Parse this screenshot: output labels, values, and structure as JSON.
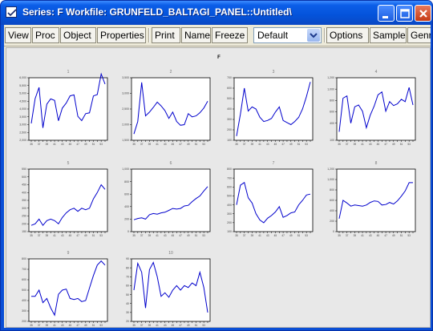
{
  "window": {
    "title": "Series: F   Workfile: GRUNFELD_BALTAGI_PANEL::Untitled\\",
    "controls": {
      "minimize": "minimize",
      "maximize": "maximize",
      "close": "close"
    }
  },
  "toolbar": {
    "view": "View",
    "proc": "Proc",
    "object": "Object",
    "properties": "Properties",
    "print": "Print",
    "name": "Name",
    "freeze": "Freeze",
    "combo_value": "Default",
    "options": "Options",
    "sample": "Sample",
    "genr": "Genr"
  },
  "graph": {
    "main_title": "F"
  },
  "chart_data": {
    "type": "line",
    "title": "F",
    "x": [
      "35",
      "36",
      "37",
      "38",
      "39",
      "40",
      "41",
      "42",
      "43",
      "44",
      "45",
      "46",
      "47",
      "48",
      "49",
      "50",
      "51",
      "52",
      "53",
      "54"
    ],
    "series_color": "#0000cc",
    "panels": [
      {
        "name": "1",
        "ylim": [
          2000,
          6000
        ],
        "yticks": [
          "2,000",
          "2,500",
          "3,000",
          "3,500",
          "4,000",
          "4,500",
          "5,000",
          "5,500",
          "6,000"
        ],
        "values": [
          3078,
          4662,
          5387,
          2792,
          4313,
          4644,
          4551,
          3244,
          4054,
          4379,
          4841,
          4901,
          3526,
          3255,
          3701,
          3756,
          4834,
          4925,
          6242,
          5594
        ]
      },
      {
        "name": "2",
        "ylim": [
          1500,
          3500
        ],
        "yticks": [
          "1,500",
          "2,000",
          "2,500",
          "3,000",
          "3,500"
        ],
        "values": [
          1700,
          2100,
          3350,
          2280,
          2400,
          2550,
          2720,
          2600,
          2450,
          2200,
          2400,
          2100,
          1980,
          2000,
          2350,
          2250,
          2280,
          2380,
          2530,
          2750
        ]
      },
      {
        "name": "3",
        "ylim": [
          100,
          700
        ],
        "yticks": [
          "100",
          "200",
          "300",
          "400",
          "500",
          "600",
          "700"
        ],
        "values": [
          140,
          350,
          600,
          380,
          420,
          400,
          320,
          280,
          290,
          310,
          370,
          420,
          290,
          270,
          250,
          280,
          320,
          400,
          520,
          660
        ]
      },
      {
        "name": "4",
        "ylim": [
          100,
          1200
        ],
        "yticks": [
          "100",
          "400",
          "600",
          "800",
          "1,000",
          "1,200"
        ],
        "values": [
          250,
          840,
          880,
          400,
          690,
          720,
          610,
          320,
          540,
          700,
          900,
          950,
          610,
          780,
          710,
          740,
          820,
          780,
          1030,
          720
        ]
      },
      {
        "name": "5",
        "ylim": [
          150,
          550
        ],
        "yticks": [
          "150",
          "200",
          "250",
          "300",
          "350",
          "400",
          "450",
          "500",
          "550"
        ],
        "values": [
          190,
          200,
          230,
          190,
          220,
          230,
          220,
          200,
          240,
          270,
          290,
          300,
          280,
          300,
          290,
          300,
          360,
          400,
          450,
          420
        ]
      },
      {
        "name": "6",
        "ylim": [
          0,
          1000
        ],
        "yticks": [
          "0",
          "200",
          "400",
          "600",
          "800",
          "1,000"
        ],
        "values": [
          190,
          210,
          220,
          200,
          270,
          290,
          280,
          300,
          310,
          340,
          370,
          360,
          370,
          410,
          420,
          480,
          530,
          570,
          650,
          720
        ]
      },
      {
        "name": "7",
        "ylim": [
          100,
          800
        ],
        "yticks": [
          "100",
          "200",
          "300",
          "400",
          "500",
          "600",
          "700",
          "800"
        ],
        "values": [
          400,
          620,
          650,
          480,
          420,
          300,
          230,
          200,
          250,
          280,
          320,
          380,
          260,
          280,
          310,
          320,
          400,
          450,
          510,
          520
        ]
      },
      {
        "name": "8",
        "ylim": [
          0,
          1200
        ],
        "yticks": [
          "0",
          "200",
          "400",
          "600",
          "800",
          "1,000",
          "1,200"
        ],
        "values": [
          250,
          600,
          550,
          490,
          510,
          500,
          490,
          510,
          560,
          590,
          580,
          510,
          520,
          560,
          530,
          590,
          680,
          780,
          940,
          940
        ]
      },
      {
        "name": "9",
        "ylim": [
          200,
          800
        ],
        "yticks": [
          "200",
          "300",
          "400",
          "500",
          "600",
          "700",
          "800"
        ],
        "values": [
          440,
          440,
          500,
          380,
          420,
          330,
          260,
          460,
          500,
          510,
          420,
          410,
          420,
          390,
          400,
          520,
          640,
          740,
          780,
          740
        ]
      },
      {
        "name": "10",
        "ylim": [
          20,
          90
        ],
        "yticks": [
          "20",
          "30",
          "40",
          "50",
          "60",
          "70",
          "80",
          "90"
        ],
        "values": [
          55,
          85,
          75,
          35,
          78,
          86,
          70,
          48,
          52,
          47,
          55,
          60,
          55,
          60,
          58,
          63,
          60,
          75,
          58,
          30
        ]
      }
    ]
  }
}
